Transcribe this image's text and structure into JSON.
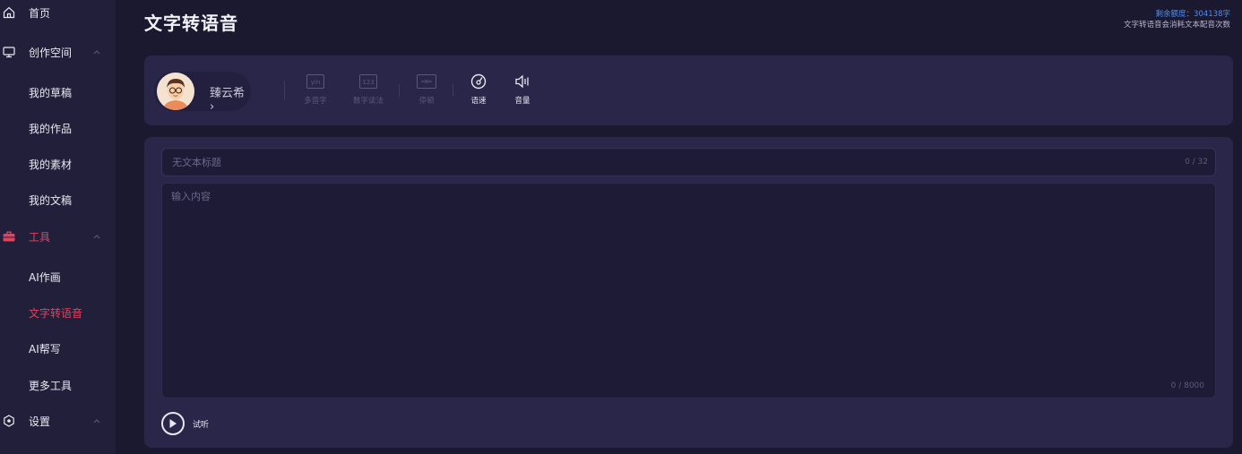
{
  "sidebar": {
    "items": [
      {
        "label": "首页",
        "icon": "home-icon"
      },
      {
        "label": "创作空间",
        "icon": "monitor-icon"
      },
      {
        "label": "我的草稿"
      },
      {
        "label": "我的作品"
      },
      {
        "label": "我的素材"
      },
      {
        "label": "我的文稿"
      },
      {
        "label": "工具",
        "icon": "toolbox-icon"
      },
      {
        "label": "AI作画"
      },
      {
        "label": "文字转语音"
      },
      {
        "label": "AI帮写"
      },
      {
        "label": "更多工具"
      },
      {
        "label": "设置",
        "icon": "settings-icon"
      }
    ],
    "active_color": "#e0445f"
  },
  "header": {
    "title": "文字转语音",
    "quota_line1": "剩余额度：304138字",
    "quota_line2": "文字转语音会消耗文本配音次数"
  },
  "toolbar": {
    "voice_name": "臻云希 ›",
    "tools": [
      {
        "label": "多音字",
        "icon": "pinyin-icon",
        "enabled": false
      },
      {
        "label": "数字读法",
        "icon": "numbers-icon",
        "enabled": false
      },
      {
        "label": "停顿",
        "icon": "pause-icon",
        "enabled": false
      },
      {
        "label": "语速",
        "icon": "speed-icon",
        "enabled": true
      },
      {
        "label": "音量",
        "icon": "volume-icon",
        "enabled": true
      }
    ]
  },
  "editor": {
    "title_placeholder": "无文本标题",
    "title_count": "0 / 32",
    "content_placeholder": "输入内容",
    "content_count": "0 / 8000",
    "play_label": "试听"
  },
  "colors": {
    "background": "#1b1930",
    "sidebar": "#221f3a",
    "card": "#29264a",
    "accent": "#e0445f",
    "quota": "#4f8df5"
  }
}
